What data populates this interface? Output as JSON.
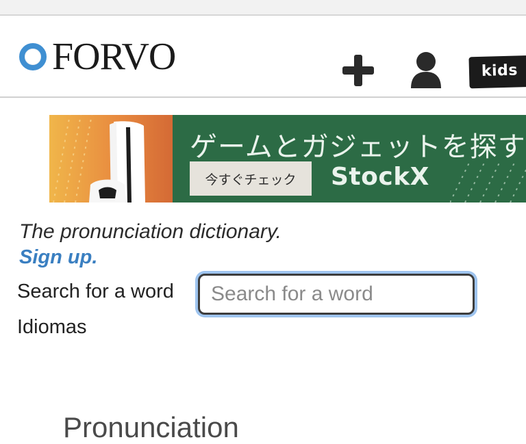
{
  "header": {
    "logo_text": "FORVO",
    "add_icon": "plus-icon",
    "user_icon": "user-icon",
    "kids_label": "kids"
  },
  "ad": {
    "headline": "ゲームとガジェットを探す",
    "cta_label": "今すぐチェック",
    "brand": "StockX",
    "colors": {
      "background": "#2c6b45",
      "accent": "#e88a3f"
    }
  },
  "main": {
    "tagline": "The pronunciation dictionary.",
    "signup_label": "Sign up.",
    "search": {
      "label": "Search for a word",
      "placeholder": "Search for a word",
      "value": ""
    },
    "languages_label": "Idiomas",
    "section_title": "Pronunciation"
  },
  "colors": {
    "logo_blue": "#3f8fd2",
    "link_blue": "#3a7fc1",
    "focus_ring": "#9ec4ef"
  }
}
